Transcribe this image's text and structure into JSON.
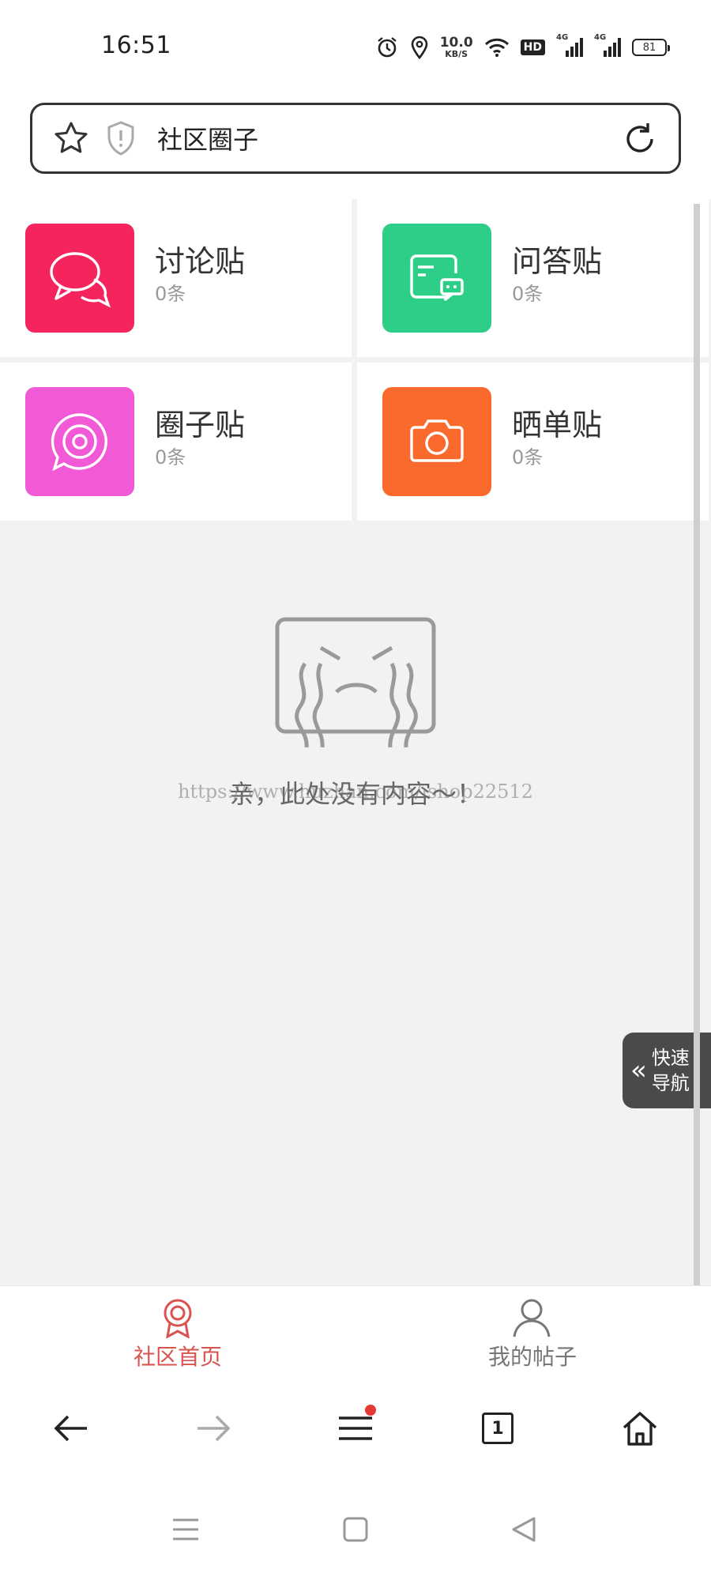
{
  "status_bar": {
    "time": "16:51",
    "net_speed_value": "10.0",
    "net_speed_unit": "KB/S",
    "hd_label": "HD",
    "network_1": "4G",
    "network_2": "4G",
    "battery": "81",
    "icons": [
      "alarm-icon",
      "location-icon",
      "wifi-icon",
      "signal-icon",
      "battery-icon"
    ]
  },
  "address_bar": {
    "title": "社区圈子",
    "icons": [
      "star-icon",
      "shield-icon",
      "reload-icon"
    ]
  },
  "categories": [
    {
      "name": "讨论贴",
      "count": "0条",
      "color": "#f5245d",
      "icon": "chat-bubbles-icon"
    },
    {
      "name": "问答贴",
      "count": "0条",
      "color": "#2dcf88",
      "icon": "qa-card-icon"
    },
    {
      "name": "圈子贴",
      "count": "0条",
      "color": "#f159d6",
      "icon": "circle-target-icon"
    },
    {
      "name": "晒单贴",
      "count": "0条",
      "color": "#fb6a2d",
      "icon": "camera-icon"
    }
  ],
  "empty_state": {
    "message": "亲，此处没有内容～！",
    "watermark": "https://www.huzhan.com/ishop22512",
    "icon": "crying-face-icon"
  },
  "quick_nav": {
    "line1": "快速",
    "line2": "导航",
    "icon": "double-chevron-left-icon"
  },
  "tabbar": {
    "items": [
      {
        "label": "社区首页",
        "active": true,
        "icon": "badge-icon"
      },
      {
        "label": "我的帖子",
        "active": false,
        "icon": "user-icon"
      }
    ],
    "active_color": "#d9534f",
    "inactive_color": "#777777"
  },
  "browser_nav": {
    "tab_count": "1",
    "icons": [
      "back-arrow-icon",
      "forward-arrow-icon",
      "menu-icon",
      "tabs-icon",
      "home-icon"
    ]
  },
  "system_nav": {
    "icons": [
      "recents-icon",
      "home-square-icon",
      "back-triangle-icon"
    ]
  }
}
